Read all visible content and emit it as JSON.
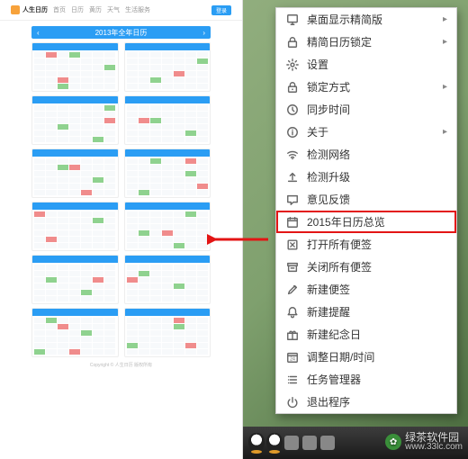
{
  "left": {
    "brand": "人生日历",
    "nav_items": [
      "首页",
      "日历",
      "黄历",
      "天气",
      "生活服务"
    ],
    "login": "登录",
    "year_bar_prev": "‹",
    "year_bar_title": "2013年全年日历",
    "year_bar_next": "›",
    "footer": "Copyright © 人生日历 版权所有"
  },
  "arrow": {
    "color": "#e31515"
  },
  "menu": {
    "items": [
      {
        "icon": "desktop-icon",
        "label": "桌面显示精简版",
        "submenu": true
      },
      {
        "icon": "lock-icon",
        "label": "精简日历锁定",
        "submenu": true
      },
      {
        "icon": "gear-icon",
        "label": "设置"
      },
      {
        "icon": "padlock-icon",
        "label": "锁定方式",
        "submenu": true
      },
      {
        "icon": "clock-icon",
        "label": "同步时间"
      },
      {
        "icon": "info-icon",
        "label": "关于",
        "submenu": true
      },
      {
        "icon": "wifi-icon",
        "label": "检测网络"
      },
      {
        "icon": "upload-icon",
        "label": "检测升级"
      },
      {
        "icon": "chat-icon",
        "label": "意见反馈"
      },
      {
        "icon": "calendar-icon",
        "label": "2015年日历总览",
        "highlight": true
      },
      {
        "icon": "close-note-icon",
        "label": "打开所有便签"
      },
      {
        "icon": "archive-icon",
        "label": "关闭所有便签"
      },
      {
        "icon": "edit-icon",
        "label": "新建便签"
      },
      {
        "icon": "bell-icon",
        "label": "新建提醒"
      },
      {
        "icon": "gift-icon",
        "label": "新建纪念日"
      },
      {
        "icon": "date-icon",
        "label": "调整日期/时间"
      },
      {
        "icon": "list-icon",
        "label": "任务管理器"
      },
      {
        "icon": "power-icon",
        "label": "退出程序"
      }
    ]
  },
  "watermark": {
    "site_cn": "绿茶软件园",
    "site_url": "www.33lc.com"
  }
}
